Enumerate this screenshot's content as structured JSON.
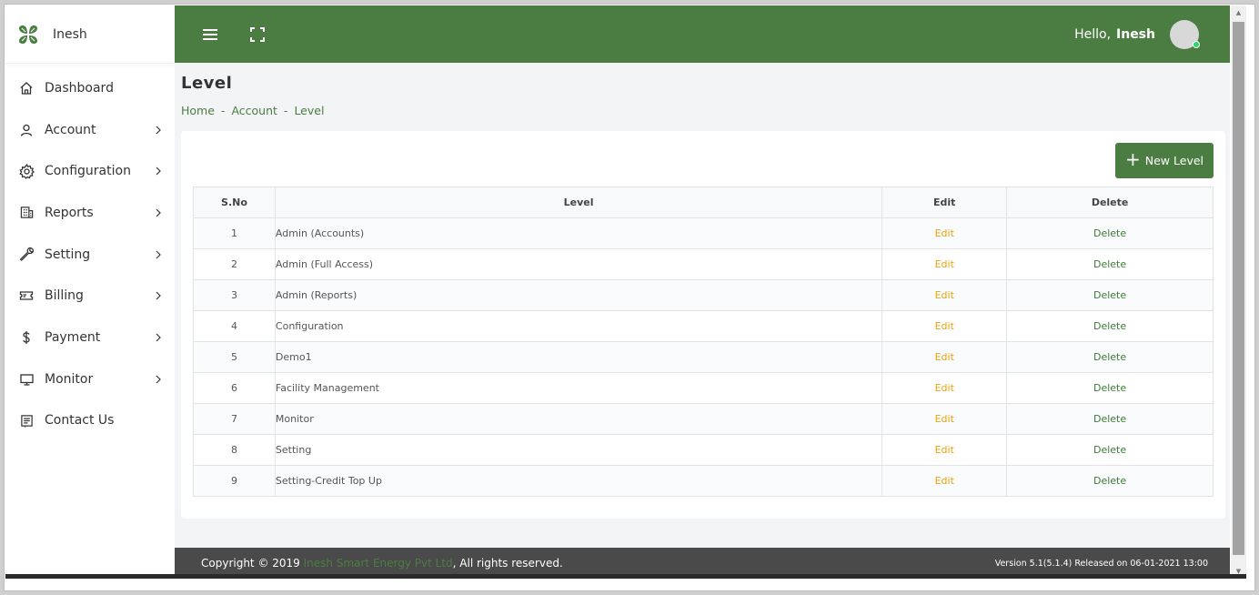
{
  "brand": {
    "name": "Inesh",
    "logo_icon": "clover-icon"
  },
  "sidebar": {
    "items": [
      {
        "label": "Dashboard",
        "icon": "home-icon",
        "has_children": false
      },
      {
        "label": "Account",
        "icon": "user-icon",
        "has_children": true
      },
      {
        "label": "Configuration",
        "icon": "gear-icon",
        "has_children": true
      },
      {
        "label": "Reports",
        "icon": "building-icon",
        "has_children": true
      },
      {
        "label": "Setting",
        "icon": "wrench-icon",
        "has_children": true
      },
      {
        "label": "Billing",
        "icon": "ticket-icon",
        "has_children": true
      },
      {
        "label": "Payment",
        "icon": "dollar-icon",
        "has_children": true
      },
      {
        "label": "Monitor",
        "icon": "monitor-icon",
        "has_children": true
      },
      {
        "label": "Contact Us",
        "icon": "contact-icon",
        "has_children": false
      }
    ]
  },
  "topbar": {
    "greeting": "Hello,",
    "user_name": "Inesh",
    "colors": {
      "bar": "#4b7d43",
      "online": "#2bd66a"
    }
  },
  "page": {
    "title": "Level",
    "breadcrumb": [
      "Home",
      "Account",
      "Level"
    ],
    "breadcrumb_sep": "-",
    "new_button_label": "New Level"
  },
  "table": {
    "headers": {
      "sno": "S.No",
      "level": "Level",
      "edit": "Edit",
      "delete": "Delete"
    },
    "rows": [
      {
        "sno": "1",
        "level": "Admin (Accounts)",
        "edit": "Edit",
        "delete": "Delete"
      },
      {
        "sno": "2",
        "level": "Admin (Full Access)",
        "edit": "Edit",
        "delete": "Delete"
      },
      {
        "sno": "3",
        "level": "Admin (Reports)",
        "edit": "Edit",
        "delete": "Delete"
      },
      {
        "sno": "4",
        "level": "Configuration",
        "edit": "Edit",
        "delete": "Delete"
      },
      {
        "sno": "5",
        "level": "Demo1",
        "edit": "Edit",
        "delete": "Delete"
      },
      {
        "sno": "6",
        "level": "Facility Management",
        "edit": "Edit",
        "delete": "Delete"
      },
      {
        "sno": "7",
        "level": "Monitor",
        "edit": "Edit",
        "delete": "Delete"
      },
      {
        "sno": "8",
        "level": "Setting",
        "edit": "Edit",
        "delete": "Delete"
      },
      {
        "sno": "9",
        "level": "Setting-Credit Top Up",
        "edit": "Edit",
        "delete": "Delete"
      }
    ],
    "colors": {
      "edit": "#e8a40e",
      "delete": "#3f7a38"
    }
  },
  "footer": {
    "copyright_prefix": "Copyright © 2019",
    "company": "Inesh Smart Energy Pvt Ltd",
    "copyright_suffix": ", All rights reserved.",
    "version": "Version 5.1(5.1.4) Released on 06-01-2021 13:00"
  }
}
